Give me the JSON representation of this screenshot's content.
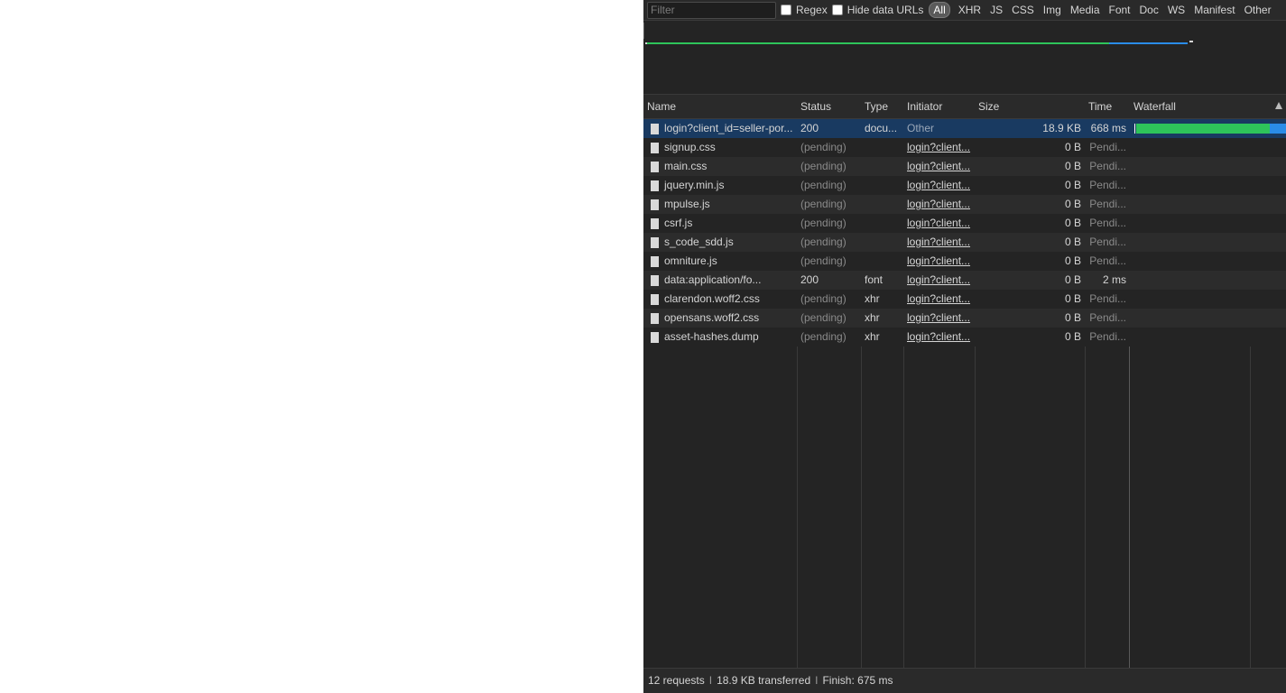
{
  "filter_bar": {
    "filter_placeholder": "Filter",
    "regex_label": "Regex",
    "hide_data_urls_label": "Hide data URLs",
    "type_filters": [
      "All",
      "XHR",
      "JS",
      "CSS",
      "Img",
      "Media",
      "Font",
      "Doc",
      "WS",
      "Manifest",
      "Other"
    ],
    "active_type": "All"
  },
  "columns": {
    "name": "Name",
    "status": "Status",
    "type": "Type",
    "initiator": "Initiator",
    "size": "Size",
    "time": "Time",
    "waterfall": "Waterfall"
  },
  "requests": [
    {
      "name": "login?client_id=seller-por...",
      "status": "200",
      "type": "docu...",
      "initiator": "Other",
      "size": "18.9 KB",
      "time": "668 ms",
      "selected": true
    },
    {
      "name": "signup.css",
      "status": "(pending)",
      "type": "",
      "initiator": "login?client...",
      "size": "0 B",
      "time": "Pendi..."
    },
    {
      "name": "main.css",
      "status": "(pending)",
      "type": "",
      "initiator": "login?client...",
      "size": "0 B",
      "time": "Pendi..."
    },
    {
      "name": "jquery.min.js",
      "status": "(pending)",
      "type": "",
      "initiator": "login?client...",
      "size": "0 B",
      "time": "Pendi..."
    },
    {
      "name": "mpulse.js",
      "status": "(pending)",
      "type": "",
      "initiator": "login?client...",
      "size": "0 B",
      "time": "Pendi..."
    },
    {
      "name": "csrf.js",
      "status": "(pending)",
      "type": "",
      "initiator": "login?client...",
      "size": "0 B",
      "time": "Pendi..."
    },
    {
      "name": "s_code_sdd.js",
      "status": "(pending)",
      "type": "",
      "initiator": "login?client...",
      "size": "0 B",
      "time": "Pendi..."
    },
    {
      "name": "omniture.js",
      "status": "(pending)",
      "type": "",
      "initiator": "login?client...",
      "size": "0 B",
      "time": "Pendi..."
    },
    {
      "name": "data:application/fo...",
      "status": "200",
      "type": "font",
      "initiator": "login?client...",
      "size": "0 B",
      "time": "2 ms"
    },
    {
      "name": "clarendon.woff2.css",
      "status": "(pending)",
      "type": "xhr",
      "initiator": "login?client...",
      "size": "0 B",
      "time": "Pendi..."
    },
    {
      "name": "opensans.woff2.css",
      "status": "(pending)",
      "type": "xhr",
      "initiator": "login?client...",
      "size": "0 B",
      "time": "Pendi..."
    },
    {
      "name": "asset-hashes.dump",
      "status": "(pending)",
      "type": "xhr",
      "initiator": "login?client...",
      "size": "0 B",
      "time": "Pendi..."
    }
  ],
  "summary": {
    "requests": "12 requests",
    "transferred": "18.9 KB transferred",
    "finish": "Finish: 675 ms"
  },
  "colors": {
    "waiting": "#2ec45a",
    "download": "#2a8ce8",
    "selected_row": "#193a61"
  }
}
